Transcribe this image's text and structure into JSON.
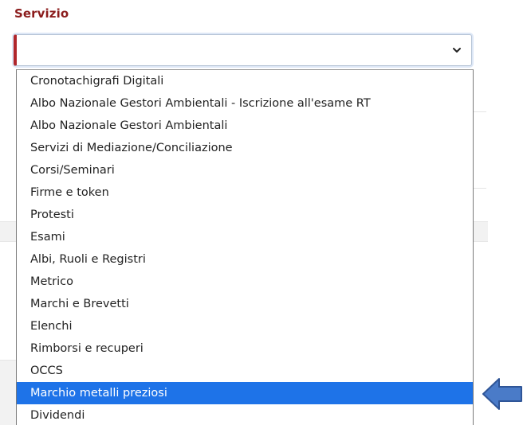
{
  "field": {
    "label": "Servizio",
    "value": ""
  },
  "dropdown": {
    "options": [
      "Cronotachigrafi Digitali",
      "Albo Nazionale Gestori Ambientali - Iscrizione all'esame RT",
      "Albo Nazionale Gestori Ambientali",
      "Servizi di Mediazione/Conciliazione",
      "Corsi/Seminari",
      "Firme e token",
      "Protesti",
      "Esami",
      "Albi, Ruoli e Registri",
      "Metrico",
      "Marchi e Brevetti",
      "Elenchi",
      "Rimborsi e recuperi",
      "OCCS",
      "Marchio metalli preziosi",
      "Dividendi"
    ],
    "selected_index": 14
  },
  "icons": {
    "chevron": "chevron-down-icon",
    "arrow": "arrow-left-icon"
  },
  "colors": {
    "label": "#8b1c1c",
    "select_border_left": "#b0262b",
    "selected_bg": "#1e73e8",
    "arrow_fill": "#4a7bc8",
    "arrow_stroke": "#2f5597"
  }
}
